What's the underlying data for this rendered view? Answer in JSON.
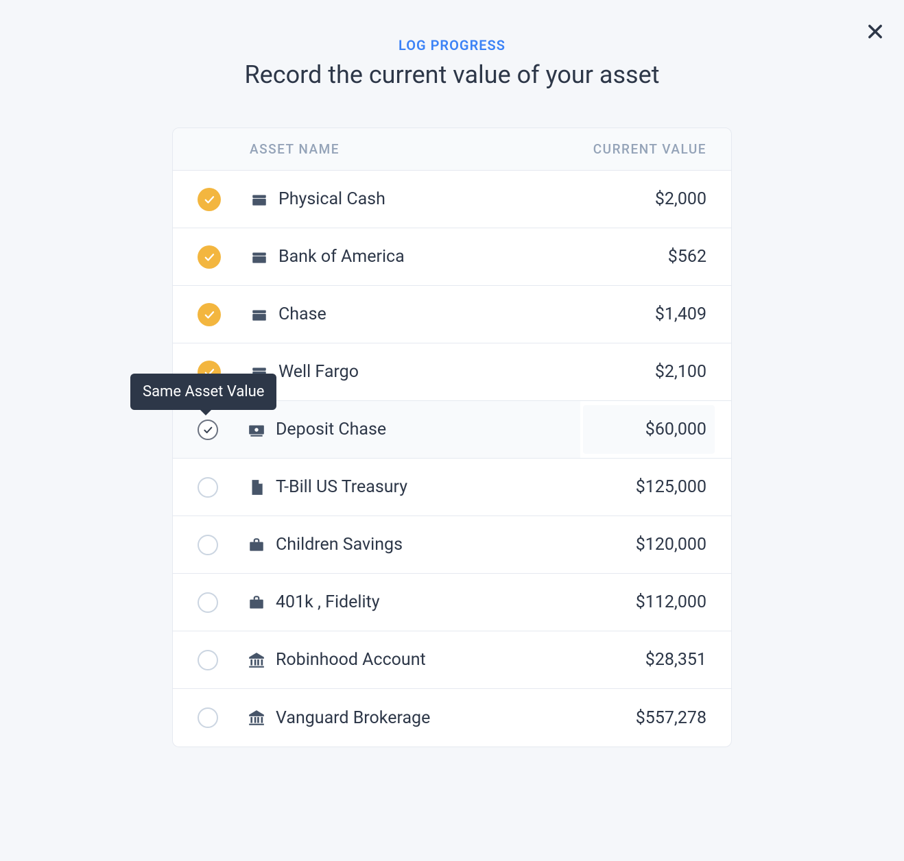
{
  "header": {
    "eyebrow": "LOG PROGRESS",
    "title": "Record the current value of your asset"
  },
  "columns": {
    "name": "ASSET NAME",
    "value": "CURRENT VALUE"
  },
  "tooltip": "Same Asset Value",
  "assets": [
    {
      "name": "Physical Cash",
      "value": "$2,000",
      "status": "checked",
      "icon": "wallet"
    },
    {
      "name": "Bank of America",
      "value": "$562",
      "status": "checked",
      "icon": "wallet"
    },
    {
      "name": "Chase",
      "value": "$1,409",
      "status": "checked",
      "icon": "wallet"
    },
    {
      "name": "Well Fargo",
      "value": "$2,100",
      "status": "checked",
      "icon": "wallet"
    },
    {
      "name": "Deposit Chase",
      "value": "$60,000",
      "status": "outline",
      "icon": "cash",
      "highlight": true
    },
    {
      "name": "T-Bill US Treasury",
      "value": "$125,000",
      "status": "empty",
      "icon": "document"
    },
    {
      "name": "Children Savings",
      "value": "$120,000",
      "status": "empty",
      "icon": "briefcase"
    },
    {
      "name": "401k , Fidelity",
      "value": "$112,000",
      "status": "empty",
      "icon": "briefcase"
    },
    {
      "name": "Robinhood Account",
      "value": "$28,351",
      "status": "empty",
      "icon": "bank"
    },
    {
      "name": "Vanguard Brokerage",
      "value": "$557,278",
      "status": "empty",
      "icon": "bank"
    }
  ]
}
